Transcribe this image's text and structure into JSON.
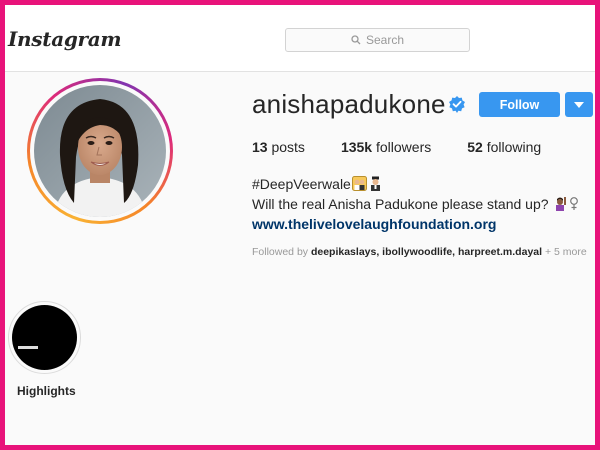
{
  "header": {
    "logo_text": "Instagram",
    "search": {
      "placeholder": "Search",
      "icon": "search-icon"
    }
  },
  "profile": {
    "username": "anishapadukone",
    "verified": true,
    "follow_label": "Follow",
    "stats": {
      "posts_count": "13",
      "posts_label": "posts",
      "followers_count": "135k",
      "followers_label": "followers",
      "following_count": "52",
      "following_label": "following"
    },
    "bio": {
      "hashtag": "#DeepVeerwale",
      "line2": "Will the real Anisha Padukone please stand up?",
      "link": "www.thelivelovelaughfoundation.org"
    },
    "followed_by": {
      "prefix": "Followed by",
      "users": "deepikaslays, ibollywoodlife, harpreet.m.dayal",
      "more": "+ 5 more"
    }
  },
  "highlights": [
    {
      "label": "Highlights"
    }
  ],
  "colors": {
    "frame_border": "#e8137a",
    "follow_button": "#3897f0",
    "link": "#003569",
    "verified_badge": "#3897f0"
  }
}
